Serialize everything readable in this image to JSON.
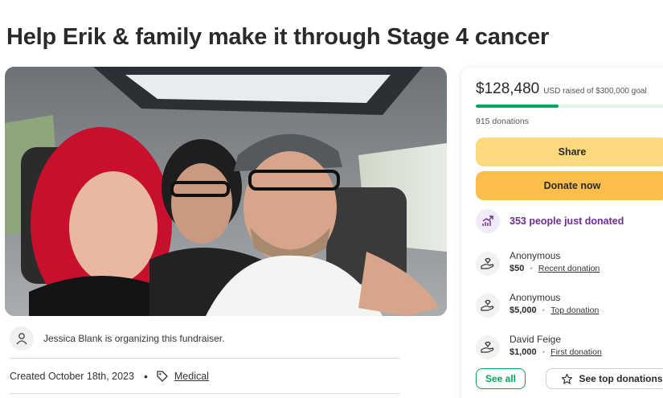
{
  "campaign": {
    "title": "Help Erik & family make it through Stage 4 cancer",
    "photo_icon": "fundraiser-photo"
  },
  "organizer": {
    "icon": "person-icon",
    "text": "Jessica Blank is organizing this fundraiser."
  },
  "meta": {
    "created": "Created October 18th, 2023",
    "bullet": "•",
    "category_icon": "tag-icon",
    "category": "Medical"
  },
  "donation_card": {
    "raised_amount": "$128,480",
    "raised_goal": "USD raised of $300,000 goal",
    "progress_fraction": 0.428,
    "donation_count": "915 donations",
    "share_label": "Share",
    "donate_label": "Donate now",
    "recent_activity": "353 people just donated",
    "recent_icon": "trending-up-icon",
    "donors": [
      {
        "name": "Anonymous",
        "amount": "$50",
        "type": "Recent donation",
        "icon": "donation-hand-icon"
      },
      {
        "name": "Anonymous",
        "amount": "$5,000",
        "type": "Top donation",
        "icon": "donation-hand-icon"
      },
      {
        "name": "David Feige",
        "amount": "$1,000",
        "type": "First donation",
        "icon": "donation-hand-icon"
      }
    ],
    "separator": "•",
    "see_all_label": "See all",
    "see_top_label": "See top donations",
    "see_top_icon": "star-icon"
  },
  "colors": {
    "brand_green": "#02a95c",
    "share_yellow": "#fcd97d",
    "donate_orange": "#fbbd4b",
    "purple": "#6f2c91"
  }
}
